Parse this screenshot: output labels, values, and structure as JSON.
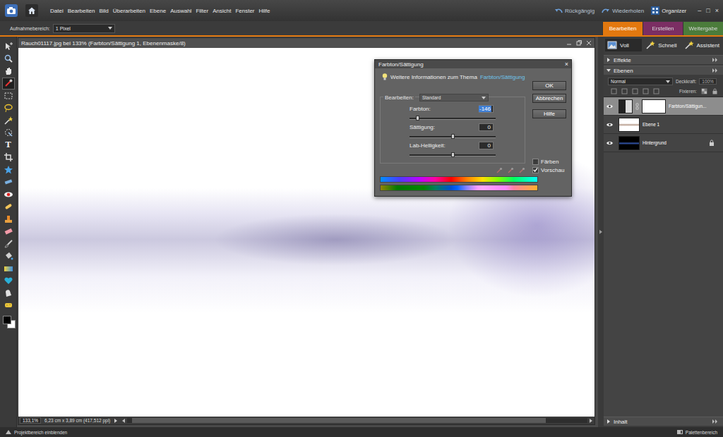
{
  "menu_bar": {
    "items": [
      "Datei",
      "Bearbeiten",
      "Bild",
      "Überarbeiten",
      "Ebene",
      "Auswahl",
      "Filter",
      "Ansicht",
      "Fenster",
      "Hilfe"
    ],
    "undo": "Rückgängig",
    "redo": "Wiederholen",
    "organizer": "Organizer",
    "window_controls": [
      "–",
      "□",
      "×"
    ]
  },
  "options_bar": {
    "label": "Aufnahmebereich:",
    "value": "1 Pixel"
  },
  "mode_tabs": [
    {
      "label": "Bearbeiten",
      "selected": true,
      "color": "#e2780f"
    },
    {
      "label": "Erstellen",
      "selected": false,
      "color": "#8c2b6d"
    },
    {
      "label": "Weitergabe",
      "selected": false,
      "color": "#4f8d3c"
    }
  ],
  "tools": [
    {
      "kind": "move",
      "selected": false
    },
    {
      "kind": "zoom",
      "selected": false
    },
    {
      "kind": "hand",
      "selected": false
    },
    {
      "kind": "eyedropper",
      "selected": true
    },
    {
      "kind": "marquee",
      "selected": false
    },
    {
      "kind": "lasso",
      "selected": false
    },
    {
      "kind": "wand",
      "selected": false
    },
    {
      "kind": "quick",
      "selected": false
    },
    {
      "kind": "type",
      "glyph": "T",
      "selected": false
    },
    {
      "kind": "crop",
      "selected": false
    },
    {
      "kind": "cookie",
      "selected": false
    },
    {
      "kind": "straighten",
      "selected": false
    },
    {
      "kind": "redeye",
      "selected": false
    },
    {
      "kind": "healing",
      "selected": false
    },
    {
      "kind": "clone",
      "selected": false
    },
    {
      "kind": "eraser",
      "selected": false
    },
    {
      "kind": "brush",
      "selected": false
    },
    {
      "kind": "bucket",
      "selected": false
    },
    {
      "kind": "gradient",
      "selected": false
    },
    {
      "kind": "shape",
      "selected": false
    },
    {
      "kind": "smudge",
      "selected": false
    },
    {
      "kind": "sponge",
      "selected": false
    }
  ],
  "colors": {
    "foreground": "#000000",
    "background": "#ffffff"
  },
  "document": {
    "title": "Rauch01117.jpg bei 133% (Farbton/Sättigung 1, Ebenenmaske/8)",
    "zoom": "133,1%",
    "size": "6,23 cm x 3,89 cm (417,512 ppi)"
  },
  "panel": {
    "view_buttons": [
      {
        "label": "Voll",
        "selected": true
      },
      {
        "label": "Schnell",
        "selected": false
      },
      {
        "label": "Assistent",
        "selected": false
      }
    ],
    "sections": [
      {
        "label": "Effekte",
        "expanded": false
      },
      {
        "label": "Ebenen",
        "expanded": true
      }
    ],
    "blend_mode": "Normal",
    "opacity_label": "Deckkraft:",
    "opacity": "100%",
    "lock_label": "Fixieren:",
    "layers": [
      {
        "name": "Farbton/Sättigun...",
        "kind": "adjustment",
        "selected": true,
        "visible": true,
        "locked": false
      },
      {
        "name": "Ebene 1",
        "kind": "pixel",
        "selected": false,
        "visible": true,
        "locked": false
      },
      {
        "name": "Hintergrund",
        "kind": "background",
        "selected": false,
        "visible": true,
        "locked": true
      }
    ],
    "bottom_section": {
      "label": "Inhalt",
      "expanded": false
    }
  },
  "dialog": {
    "title": "Farbton/Sättigung",
    "close": "×",
    "info_text": "Weitere Informationen zum Thema",
    "info_link": "Farbton/Sättigung",
    "buttons": [
      "OK",
      "Abbrechen",
      "Hilfe"
    ],
    "edit_label": "Bearbeiten:",
    "edit_value": "Standard",
    "sliders": [
      {
        "label": "Farbton:",
        "value": "-146",
        "level": 0.094,
        "focused": true
      },
      {
        "label": "Sättigung:",
        "value": "0",
        "level": 0.5,
        "focused": false
      },
      {
        "label": "Lab-Helligkeit:",
        "value": "0",
        "level": 0.5,
        "focused": false
      }
    ],
    "checkboxes": [
      {
        "label": "Färben",
        "checked": false
      },
      {
        "label": "Vorschau",
        "checked": true
      }
    ]
  },
  "footer": {
    "left": "Projektbereich einblenden",
    "right": "Palettenbereich"
  }
}
